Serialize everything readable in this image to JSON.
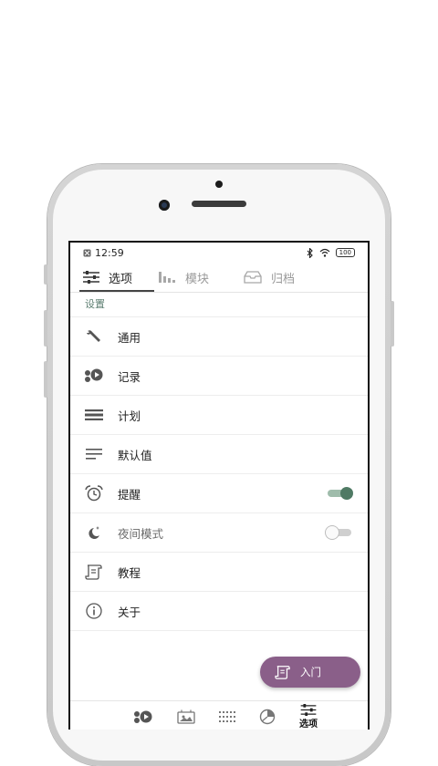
{
  "status_bar": {
    "time": "12:59",
    "battery": "100"
  },
  "tabs": [
    {
      "label": "选项",
      "icon": "sliders-icon",
      "active": true
    },
    {
      "label": "模块",
      "icon": "histogram-icon",
      "active": false
    },
    {
      "label": "归档",
      "icon": "archive-box-icon",
      "active": false
    }
  ],
  "settings": {
    "section_title": "设置",
    "items": [
      {
        "label": "通用",
        "icon": "wrench-icon"
      },
      {
        "label": "记录",
        "icon": "record-icon"
      },
      {
        "label": "计划",
        "icon": "schedule-icon"
      },
      {
        "label": "默认值",
        "icon": "lines-icon"
      },
      {
        "label": "提醒",
        "icon": "alarm-icon",
        "toggle": true,
        "toggle_on": true
      },
      {
        "label": "夜间模式",
        "icon": "moon-icon",
        "toggle": true,
        "toggle_on": false
      },
      {
        "label": "教程",
        "icon": "scroll-icon"
      },
      {
        "label": "关于",
        "icon": "info-icon"
      }
    ]
  },
  "fab": {
    "label": "入门",
    "icon": "scroll-icon",
    "color": "#8a5f89"
  },
  "bottom_nav": [
    {
      "label": "",
      "icon": "record-icon"
    },
    {
      "label": "",
      "icon": "media-frame-icon"
    },
    {
      "label": "",
      "icon": "grid-dots-icon"
    },
    {
      "label": "",
      "icon": "pie-chart-icon"
    },
    {
      "label": "选项",
      "icon": "sliders-icon",
      "active": true
    }
  ],
  "colors": {
    "accent": "#4f7a64",
    "section_header": "#5d7f72",
    "fab": "#8a5f89"
  }
}
